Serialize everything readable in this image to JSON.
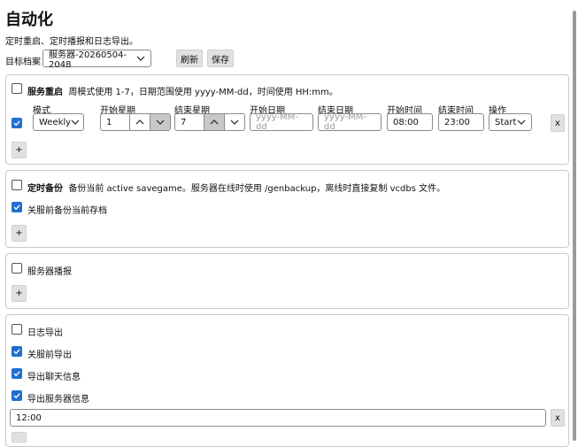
{
  "header": {
    "title": "自动化",
    "subtitle": "定时重启、定时播报和日志导出。"
  },
  "profile": {
    "label": "目标档案",
    "selected": "服务器-20260504-2048",
    "refresh_label": "刷新",
    "save_label": "保存"
  },
  "restart": {
    "title": "服务重启",
    "description": "周模式使用 1-7，日期范围使用 yyyy-MM-dd，时间使用 HH:mm。",
    "columns": {
      "mode": "模式",
      "start_weekday": "开始星期",
      "end_weekday": "结束星期",
      "start_date": "开始日期",
      "end_date": "结束日期",
      "start_time": "开始时间",
      "end_time": "结束时间",
      "action": "操作"
    },
    "row": {
      "mode": "Weekly",
      "start_weekday": "1",
      "end_weekday": "7",
      "start_date_placeholder": "yyyy-MM-dd",
      "end_date_placeholder": "yyyy-MM-dd",
      "start_time": "08:00",
      "end_time": "23:00",
      "action": "Start",
      "remove_label": "x"
    },
    "add_label": "+"
  },
  "backup": {
    "title": "定时备份",
    "description": "备份当前 active savegame。服务器在线时使用 /genbackup，离线时直接复制 vcdbs 文件。",
    "option_label": "关服前备份当前存档",
    "add_label": "+"
  },
  "broadcast": {
    "title": "服务器播报",
    "add_label": "+"
  },
  "logs": {
    "title": "日志导出",
    "options": [
      "关服前导出",
      "导出聊天信息",
      "导出服务器信息"
    ],
    "time_value": "12:00",
    "remove_label": "x"
  }
}
